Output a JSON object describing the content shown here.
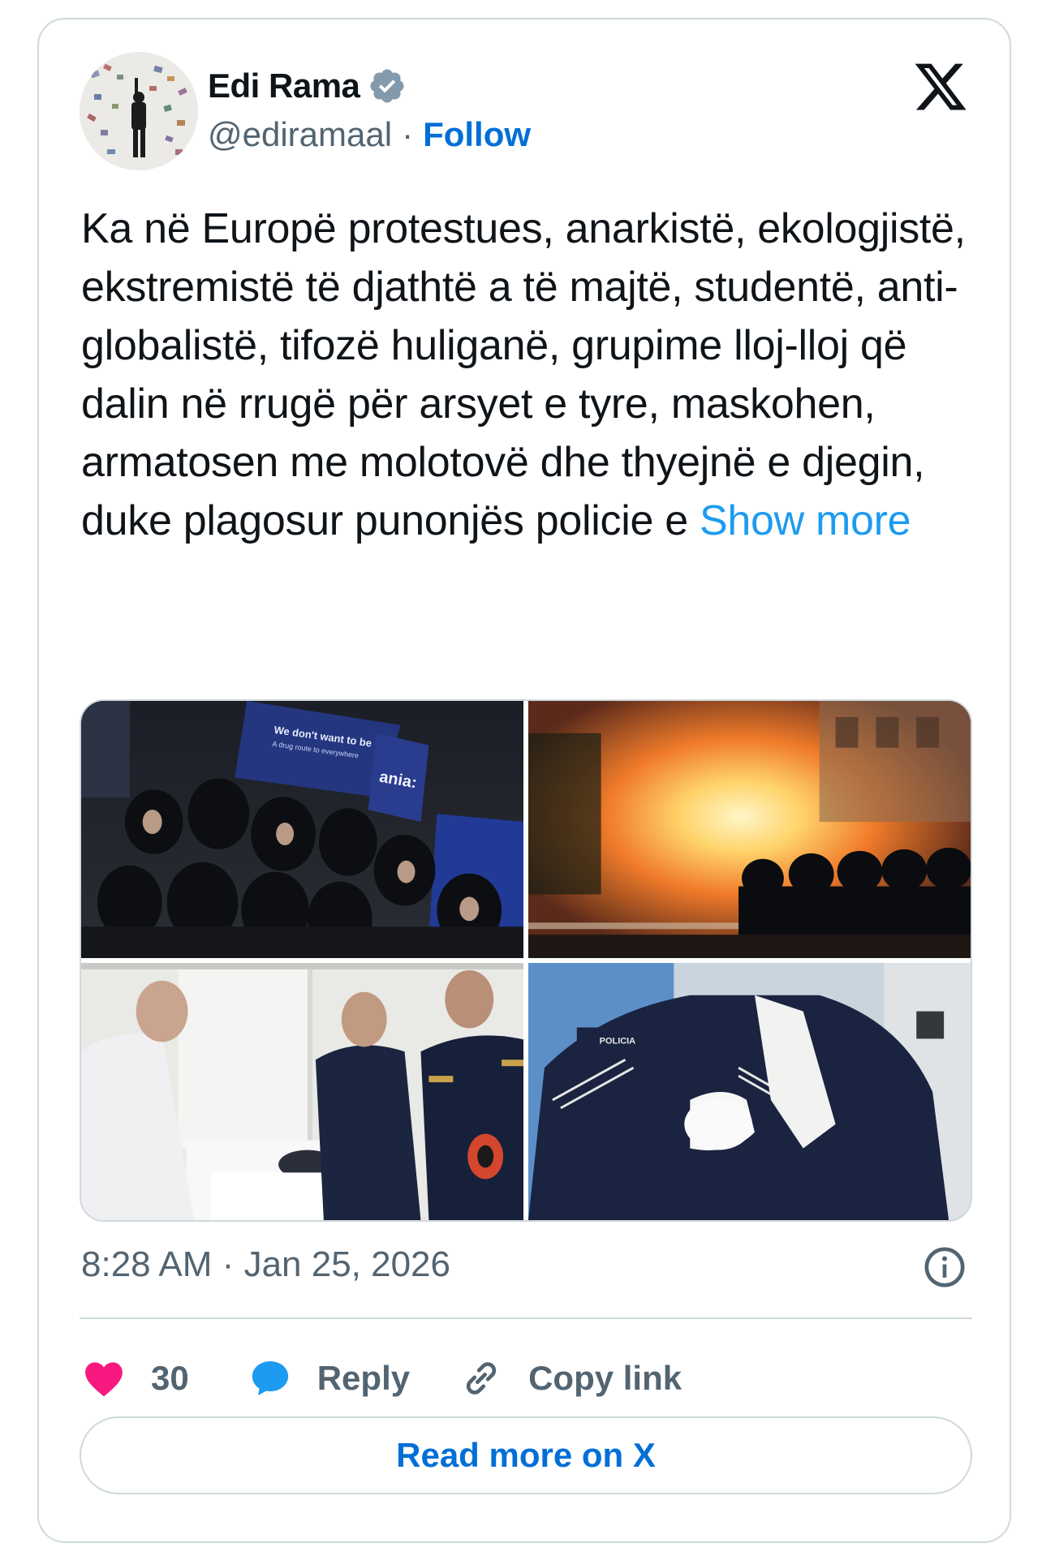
{
  "author": {
    "name": "Edi Rama",
    "handle": "@ediramaal",
    "separator": "·",
    "follow_label": "Follow",
    "verified": true
  },
  "tweet": {
    "text": "Ka në Europë protestues, anarkistë, ekologjistë, ekstremistë të djathtë a të majtë, studentë, anti-globalistë, tifozë huliganë, grupime lloj-lloj që dalin në rrugë për arsyet e tyre, maskohen, armatosen me molotovë dhe thyejnë e djegin, duke plagosur punonjës policie e",
    "show_more_label": "Show more"
  },
  "media": {
    "photos": [
      {
        "alt": "protest crowd with blue signs",
        "sign_text": "We don't want to be",
        "sign_sub": "A drug route to everywhere",
        "sign2": "ania:"
      },
      {
        "alt": "fire and riot police"
      },
      {
        "alt": "injured officer in hospital bed"
      },
      {
        "alt": "police officer with arm in sling",
        "badge": "POLICIA"
      }
    ]
  },
  "meta": {
    "time": "8:28 AM",
    "separator": "·",
    "date": "Jan 25, 2026"
  },
  "actions": {
    "like_count": "30",
    "reply_label": "Reply",
    "copy_label": "Copy link"
  },
  "footer": {
    "read_more_label": "Read more on X"
  },
  "colors": {
    "link_blue": "#1d9bf0",
    "follow_blue": "#006fd6",
    "like_red": "#f91880",
    "muted": "#536471",
    "border": "#cfd9de"
  },
  "icons": [
    "verified-badge-icon",
    "x-logo-icon",
    "info-icon",
    "heart-icon",
    "reply-bubble-icon",
    "link-icon"
  ]
}
